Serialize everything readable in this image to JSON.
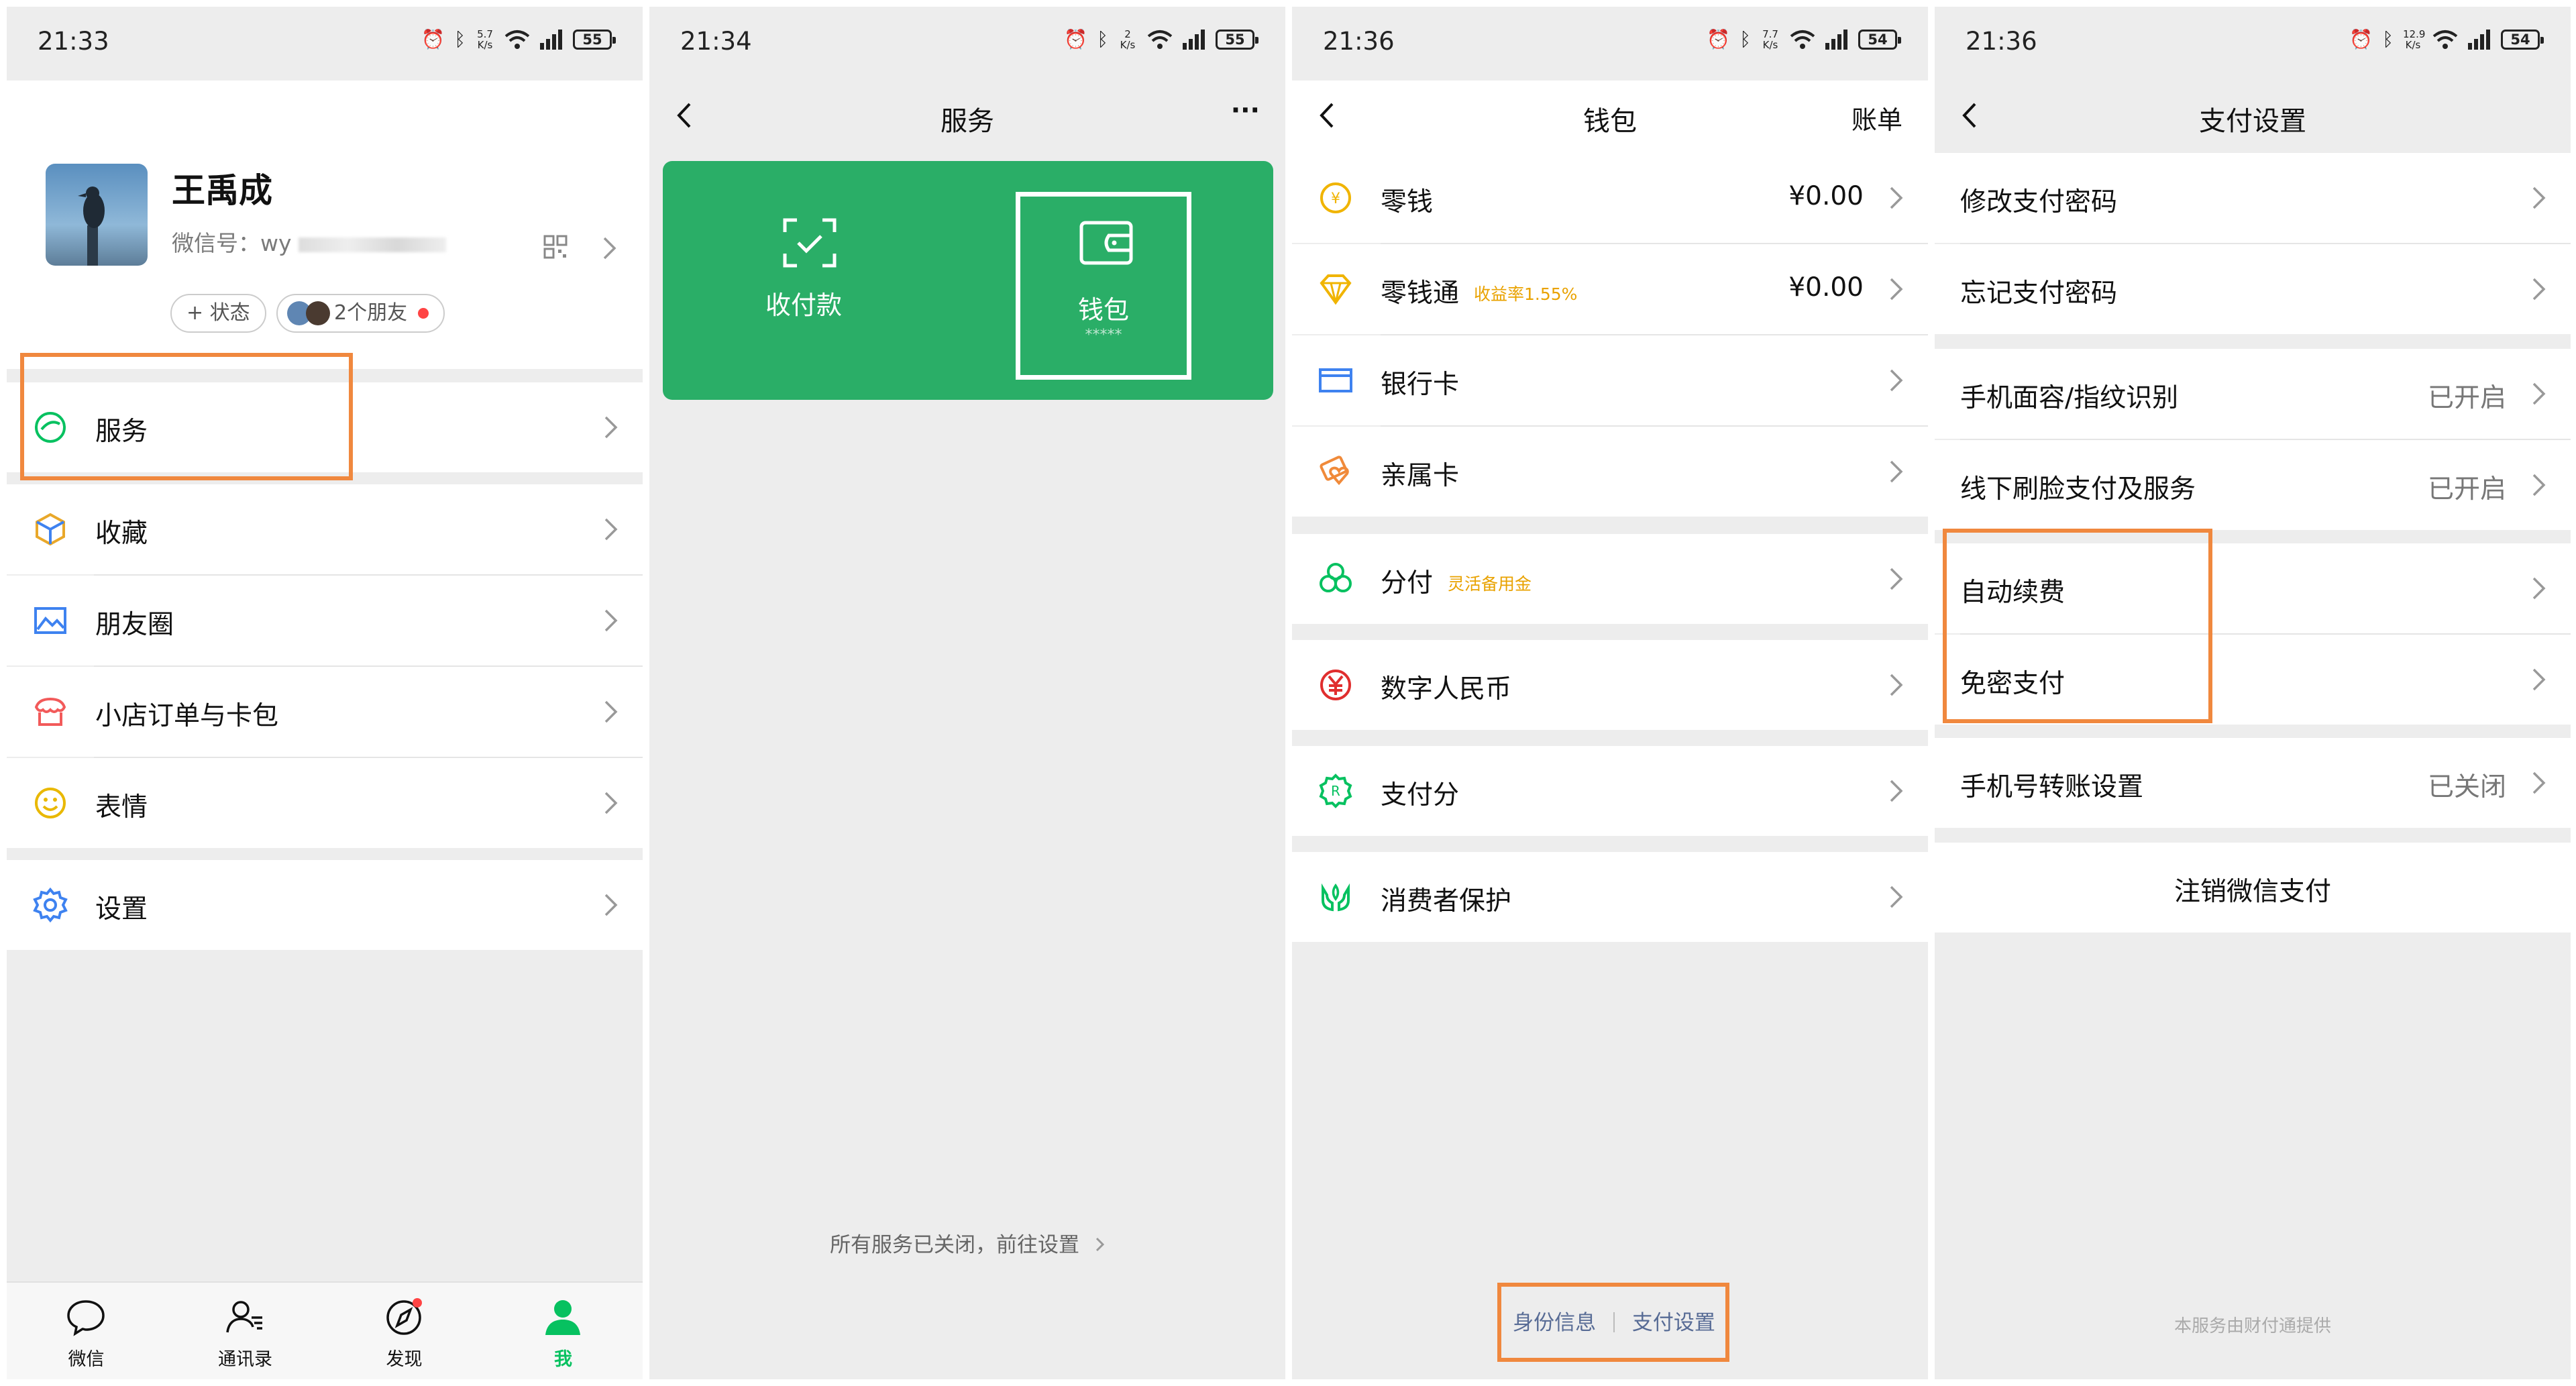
{
  "panel1": {
    "status": {
      "time": "21:33",
      "speed": "5.7 K/s",
      "battery": "55"
    },
    "profile": {
      "name": "王禹成",
      "wechat_label": "微信号：",
      "wechat_id": "wy",
      "status_btn": "+ 状态",
      "friends": "2个朋友"
    },
    "menu": {
      "services": "服务",
      "favorites": "收藏",
      "moments": "朋友圈",
      "orders": "小店订单与卡包",
      "stickers": "表情",
      "settings": "设置"
    },
    "tabs": [
      "微信",
      "通讯录",
      "发现",
      "我"
    ],
    "colors": {
      "accent": "#07c160",
      "highlight": "#f0883e"
    }
  },
  "panel2": {
    "status": {
      "time": "21:34",
      "speed": "2 K/s",
      "battery": "55"
    },
    "title": "服务",
    "more": "···",
    "tiles": {
      "collect": "收付款",
      "wallet": "钱包",
      "wallet_mask": "*****"
    },
    "footer": "所有服务已关闭，前往设置",
    "colors": {
      "banner": "#2aae67"
    }
  },
  "panel3": {
    "status": {
      "time": "21:36",
      "speed": "7.7 K/s",
      "battery": "54"
    },
    "title": "钱包",
    "bill": "账单",
    "rows": {
      "change": {
        "label": "零钱",
        "value": "¥0.00"
      },
      "lct": {
        "label": "零钱通",
        "tag": "收益率1.55%",
        "value": "¥0.00"
      },
      "card": {
        "label": "银行卡"
      },
      "family": {
        "label": "亲属卡"
      },
      "fenfu": {
        "label": "分付",
        "tag": "灵活备用金"
      },
      "ecny": {
        "label": "数字人民币"
      },
      "score": {
        "label": "支付分"
      },
      "protect": {
        "label": "消费者保护"
      }
    },
    "footer": {
      "identity": "身份信息",
      "paysettings": "支付设置"
    },
    "colors": {
      "link": "#576b95"
    }
  },
  "panel4": {
    "status": {
      "time": "21:36",
      "speed": "12.9 K/s",
      "battery": "54"
    },
    "title": "支付设置",
    "rows": {
      "modify": "修改支付密码",
      "forgot": "忘记支付密码",
      "biometric": {
        "label": "手机面容/指纹识别",
        "value": "已开启"
      },
      "offline": {
        "label": "线下刷脸支付及服务",
        "value": "已开启"
      },
      "renew": "自动续费",
      "nopwd": "免密支付",
      "phone": {
        "label": "手机号转账设置",
        "value": "已关闭"
      },
      "close": "注销微信支付"
    },
    "footer": "本服务由财付通提供"
  }
}
